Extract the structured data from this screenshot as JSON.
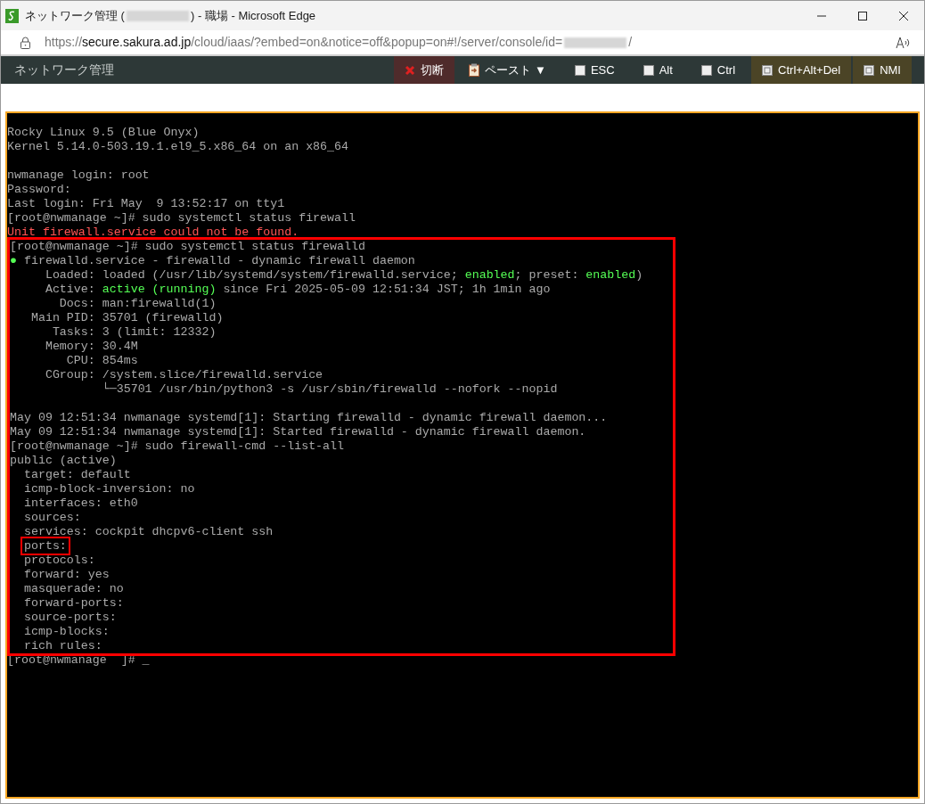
{
  "window": {
    "title_before": "ネットワーク管理 (",
    "title_after": ") - 職場 - Microsoft Edge"
  },
  "address_bar": {
    "url_host_prefix": "https://",
    "url_host": "secure.sakura.ad.jp",
    "url_path": "/cloud/iaas/?embed=on&notice=off&popup=on#!/server/console/id=",
    "url_after": "/"
  },
  "toolbar": {
    "title": "ネットワーク管理",
    "buttons": [
      {
        "kind": "disconnect",
        "label": "切断"
      },
      {
        "kind": "paste",
        "label": "ペースト ▼"
      },
      {
        "kind": "toggle",
        "label": "ESC",
        "checked": false
      },
      {
        "kind": "toggle",
        "label": "Alt",
        "checked": false
      },
      {
        "kind": "toggle",
        "label": "Ctrl",
        "checked": false
      },
      {
        "kind": "key",
        "label": "Ctrl+Alt+Del"
      },
      {
        "kind": "key",
        "label": "NMI"
      }
    ]
  },
  "console": {
    "blocks": [
      {
        "kind": "plain",
        "lines": [
          {
            "kind": "text",
            "segments": [
              {
                "text": "Rocky Linux 9.5 (Blue Onyx)",
                "kind": "plain"
              }
            ]
          },
          {
            "kind": "text",
            "segments": [
              {
                "text": "Kernel 5.14.0-503.19.1.el9_5.x86_64 on an x86_64",
                "kind": "plain"
              }
            ]
          },
          {
            "kind": "blank"
          },
          {
            "kind": "text",
            "segments": [
              {
                "text": "nwmanage login: root",
                "kind": "plain"
              }
            ]
          },
          {
            "kind": "text",
            "segments": [
              {
                "text": "Password:",
                "kind": "plain"
              }
            ]
          },
          {
            "kind": "text",
            "segments": [
              {
                "text": "Last login: Fri May  9 13:52:17 on tty1",
                "kind": "plain"
              }
            ]
          },
          {
            "kind": "text",
            "segments": [
              {
                "text": "[root@nwmanage ~]# sudo systemctl status firewall",
                "kind": "plain"
              }
            ]
          },
          {
            "kind": "text",
            "segments": [
              {
                "text": "Unit firewall.service could not be found.",
                "kind": "error"
              }
            ]
          }
        ]
      },
      {
        "kind": "highlighted",
        "lines": [
          {
            "kind": "text",
            "segments": [
              {
                "text": "[root@nwmanage ~]# sudo systemctl status firewalld",
                "kind": "plain"
              }
            ]
          },
          {
            "kind": "text",
            "segments": [
              {
                "text": "●",
                "kind": "green"
              },
              {
                "text": " firewalld.service - firewalld - dynamic firewall daemon",
                "kind": "plain"
              }
            ]
          },
          {
            "kind": "text",
            "segments": [
              {
                "text": "     Loaded: loaded (/usr/lib/systemd/system/firewalld.service; ",
                "kind": "plain"
              },
              {
                "text": "enabled",
                "kind": "green"
              },
              {
                "text": "; preset: ",
                "kind": "plain"
              },
              {
                "text": "enabled",
                "kind": "green"
              },
              {
                "text": ")",
                "kind": "plain"
              }
            ]
          },
          {
            "kind": "text",
            "segments": [
              {
                "text": "     Active: ",
                "kind": "plain"
              },
              {
                "text": "active (running)",
                "kind": "green"
              },
              {
                "text": " since Fri 2025-05-09 12:51:34 JST; 1h 1min ago",
                "kind": "plain"
              }
            ]
          },
          {
            "kind": "text",
            "segments": [
              {
                "text": "       Docs: man:firewalld(1)",
                "kind": "plain"
              }
            ]
          },
          {
            "kind": "text",
            "segments": [
              {
                "text": "   Main PID: 35701 (firewalld)",
                "kind": "plain"
              }
            ]
          },
          {
            "kind": "text",
            "segments": [
              {
                "text": "      Tasks: 3 (limit: 12332)",
                "kind": "plain"
              }
            ]
          },
          {
            "kind": "text",
            "segments": [
              {
                "text": "     Memory: 30.4M",
                "kind": "plain"
              }
            ]
          },
          {
            "kind": "text",
            "segments": [
              {
                "text": "        CPU: 854ms",
                "kind": "plain"
              }
            ]
          },
          {
            "kind": "text",
            "segments": [
              {
                "text": "     CGroup: /system.slice/firewalld.service",
                "kind": "plain"
              }
            ]
          },
          {
            "kind": "text",
            "segments": [
              {
                "text": "             └─35701 /usr/bin/python3 -s /usr/sbin/firewalld --nofork --nopid",
                "kind": "plain"
              }
            ]
          },
          {
            "kind": "blank"
          },
          {
            "kind": "text",
            "segments": [
              {
                "text": "May 09 12:51:34 nwmanage systemd[1]: Starting firewalld - dynamic firewall daemon...",
                "kind": "plain"
              }
            ]
          },
          {
            "kind": "text",
            "segments": [
              {
                "text": "May 09 12:51:34 nwmanage systemd[1]: Started firewalld - dynamic firewall daemon.",
                "kind": "plain"
              }
            ]
          },
          {
            "kind": "text",
            "segments": [
              {
                "text": "[root@nwmanage ~]# sudo firewall-cmd --list-all",
                "kind": "plain"
              }
            ]
          },
          {
            "kind": "text",
            "segments": [
              {
                "text": "public (active)",
                "kind": "plain"
              }
            ]
          },
          {
            "kind": "text",
            "segments": [
              {
                "text": "  target: default",
                "kind": "plain"
              }
            ]
          },
          {
            "kind": "text",
            "segments": [
              {
                "text": "  icmp-block-inversion: no",
                "kind": "plain"
              }
            ]
          },
          {
            "kind": "text",
            "segments": [
              {
                "text": "  interfaces: eth0",
                "kind": "plain"
              }
            ]
          },
          {
            "kind": "text",
            "segments": [
              {
                "text": "  sources:",
                "kind": "plain"
              }
            ]
          },
          {
            "kind": "text",
            "segments": [
              {
                "text": "  services: cockpit dhcpv6-client ssh",
                "kind": "plain"
              }
            ]
          },
          {
            "kind": "text",
            "segments": [
              {
                "text": "  ports:",
                "kind": "boxed"
              }
            ]
          },
          {
            "kind": "text",
            "segments": [
              {
                "text": "  protocols:",
                "kind": "plain"
              }
            ]
          },
          {
            "kind": "text",
            "segments": [
              {
                "text": "  forward: yes",
                "kind": "plain"
              }
            ]
          },
          {
            "kind": "text",
            "segments": [
              {
                "text": "  masquerade: no",
                "kind": "plain"
              }
            ]
          },
          {
            "kind": "text",
            "segments": [
              {
                "text": "  forward-ports:",
                "kind": "plain"
              }
            ]
          },
          {
            "kind": "text",
            "segments": [
              {
                "text": "  source-ports:",
                "kind": "plain"
              }
            ]
          },
          {
            "kind": "text",
            "segments": [
              {
                "text": "  icmp-blocks:",
                "kind": "plain"
              }
            ]
          },
          {
            "kind": "text",
            "segments": [
              {
                "text": "  rich rules:",
                "kind": "plain"
              }
            ]
          }
        ]
      },
      {
        "kind": "plain",
        "lines": [
          {
            "kind": "text",
            "segments": [
              {
                "text": "[root@nwmanage  ]# _",
                "kind": "plain"
              }
            ]
          }
        ]
      }
    ]
  }
}
